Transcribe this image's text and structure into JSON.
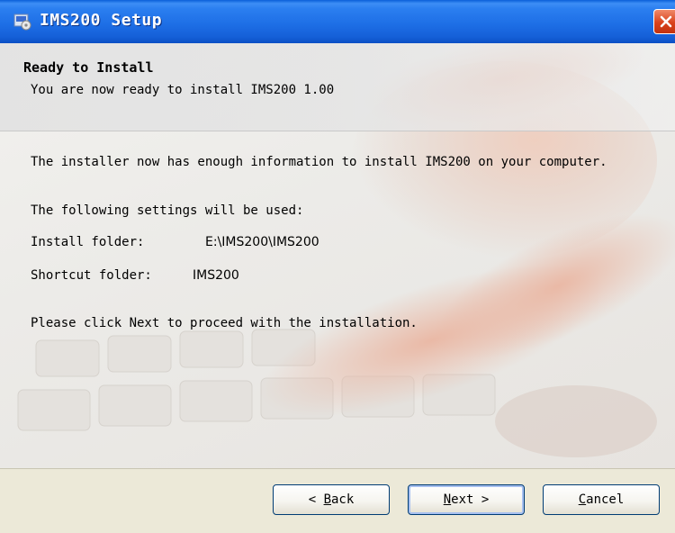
{
  "window": {
    "title": "IMS200 Setup"
  },
  "header": {
    "title": "Ready to Install",
    "subtitle": "You are now ready to install IMS200 1.00"
  },
  "body": {
    "intro": "The installer now has enough information to install IMS200 on your computer.",
    "settings_heading": "The following settings will be used:",
    "install_folder_label": "Install folder:",
    "install_folder_value": "E:\\IMS200\\IMS200",
    "shortcut_folder_label": "Shortcut folder:",
    "shortcut_folder_value": "IMS200",
    "instruction": "Please click Next to proceed with the installation."
  },
  "buttons": {
    "back": {
      "accel": "B",
      "rest": "ack",
      "prefix": "< "
    },
    "next": {
      "accel": "N",
      "rest": "ext >"
    },
    "cancel": {
      "accel": "C",
      "rest": "ancel"
    }
  },
  "icons": {
    "app": "setup-app-icon",
    "close": "close-icon"
  },
  "colors": {
    "title_bar": "#1e6fe6",
    "close": "#d9421c",
    "face": "#ece9d8"
  }
}
